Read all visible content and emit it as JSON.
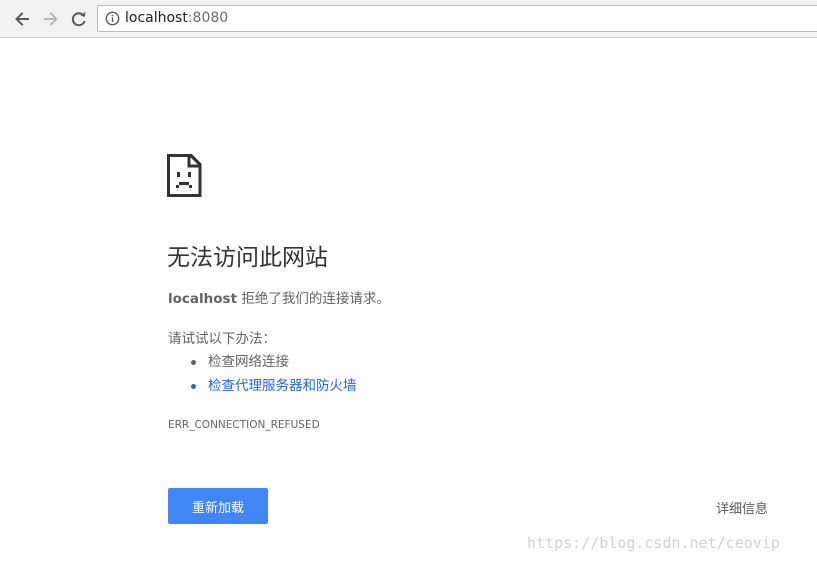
{
  "browser": {
    "url_host": "localhost",
    "url_port": ":8080",
    "icons": {
      "back": "back-arrow-icon",
      "forward": "forward-arrow-icon",
      "reload": "reload-icon",
      "site_info": "info-icon"
    }
  },
  "error_page": {
    "icon": "sad-tab-icon",
    "title": "无法访问此网站",
    "host": "localhost",
    "message": " 拒绝了我们的连接请求。",
    "suggestions_heading": "请试试以下办法：",
    "suggestions": [
      {
        "label": "检查网络连接",
        "is_link": false
      },
      {
        "label": "检查代理服务器和防火墙",
        "is_link": true
      }
    ],
    "error_code": "ERR_CONNECTION_REFUSED",
    "reload_label": "重新加载",
    "details_label": "详细信息"
  },
  "watermark": "https://blog.csdn.net/ceovip",
  "colors": {
    "button": "#4285f4",
    "link": "#2a66d3",
    "text": "#646464",
    "title": "#333333"
  }
}
